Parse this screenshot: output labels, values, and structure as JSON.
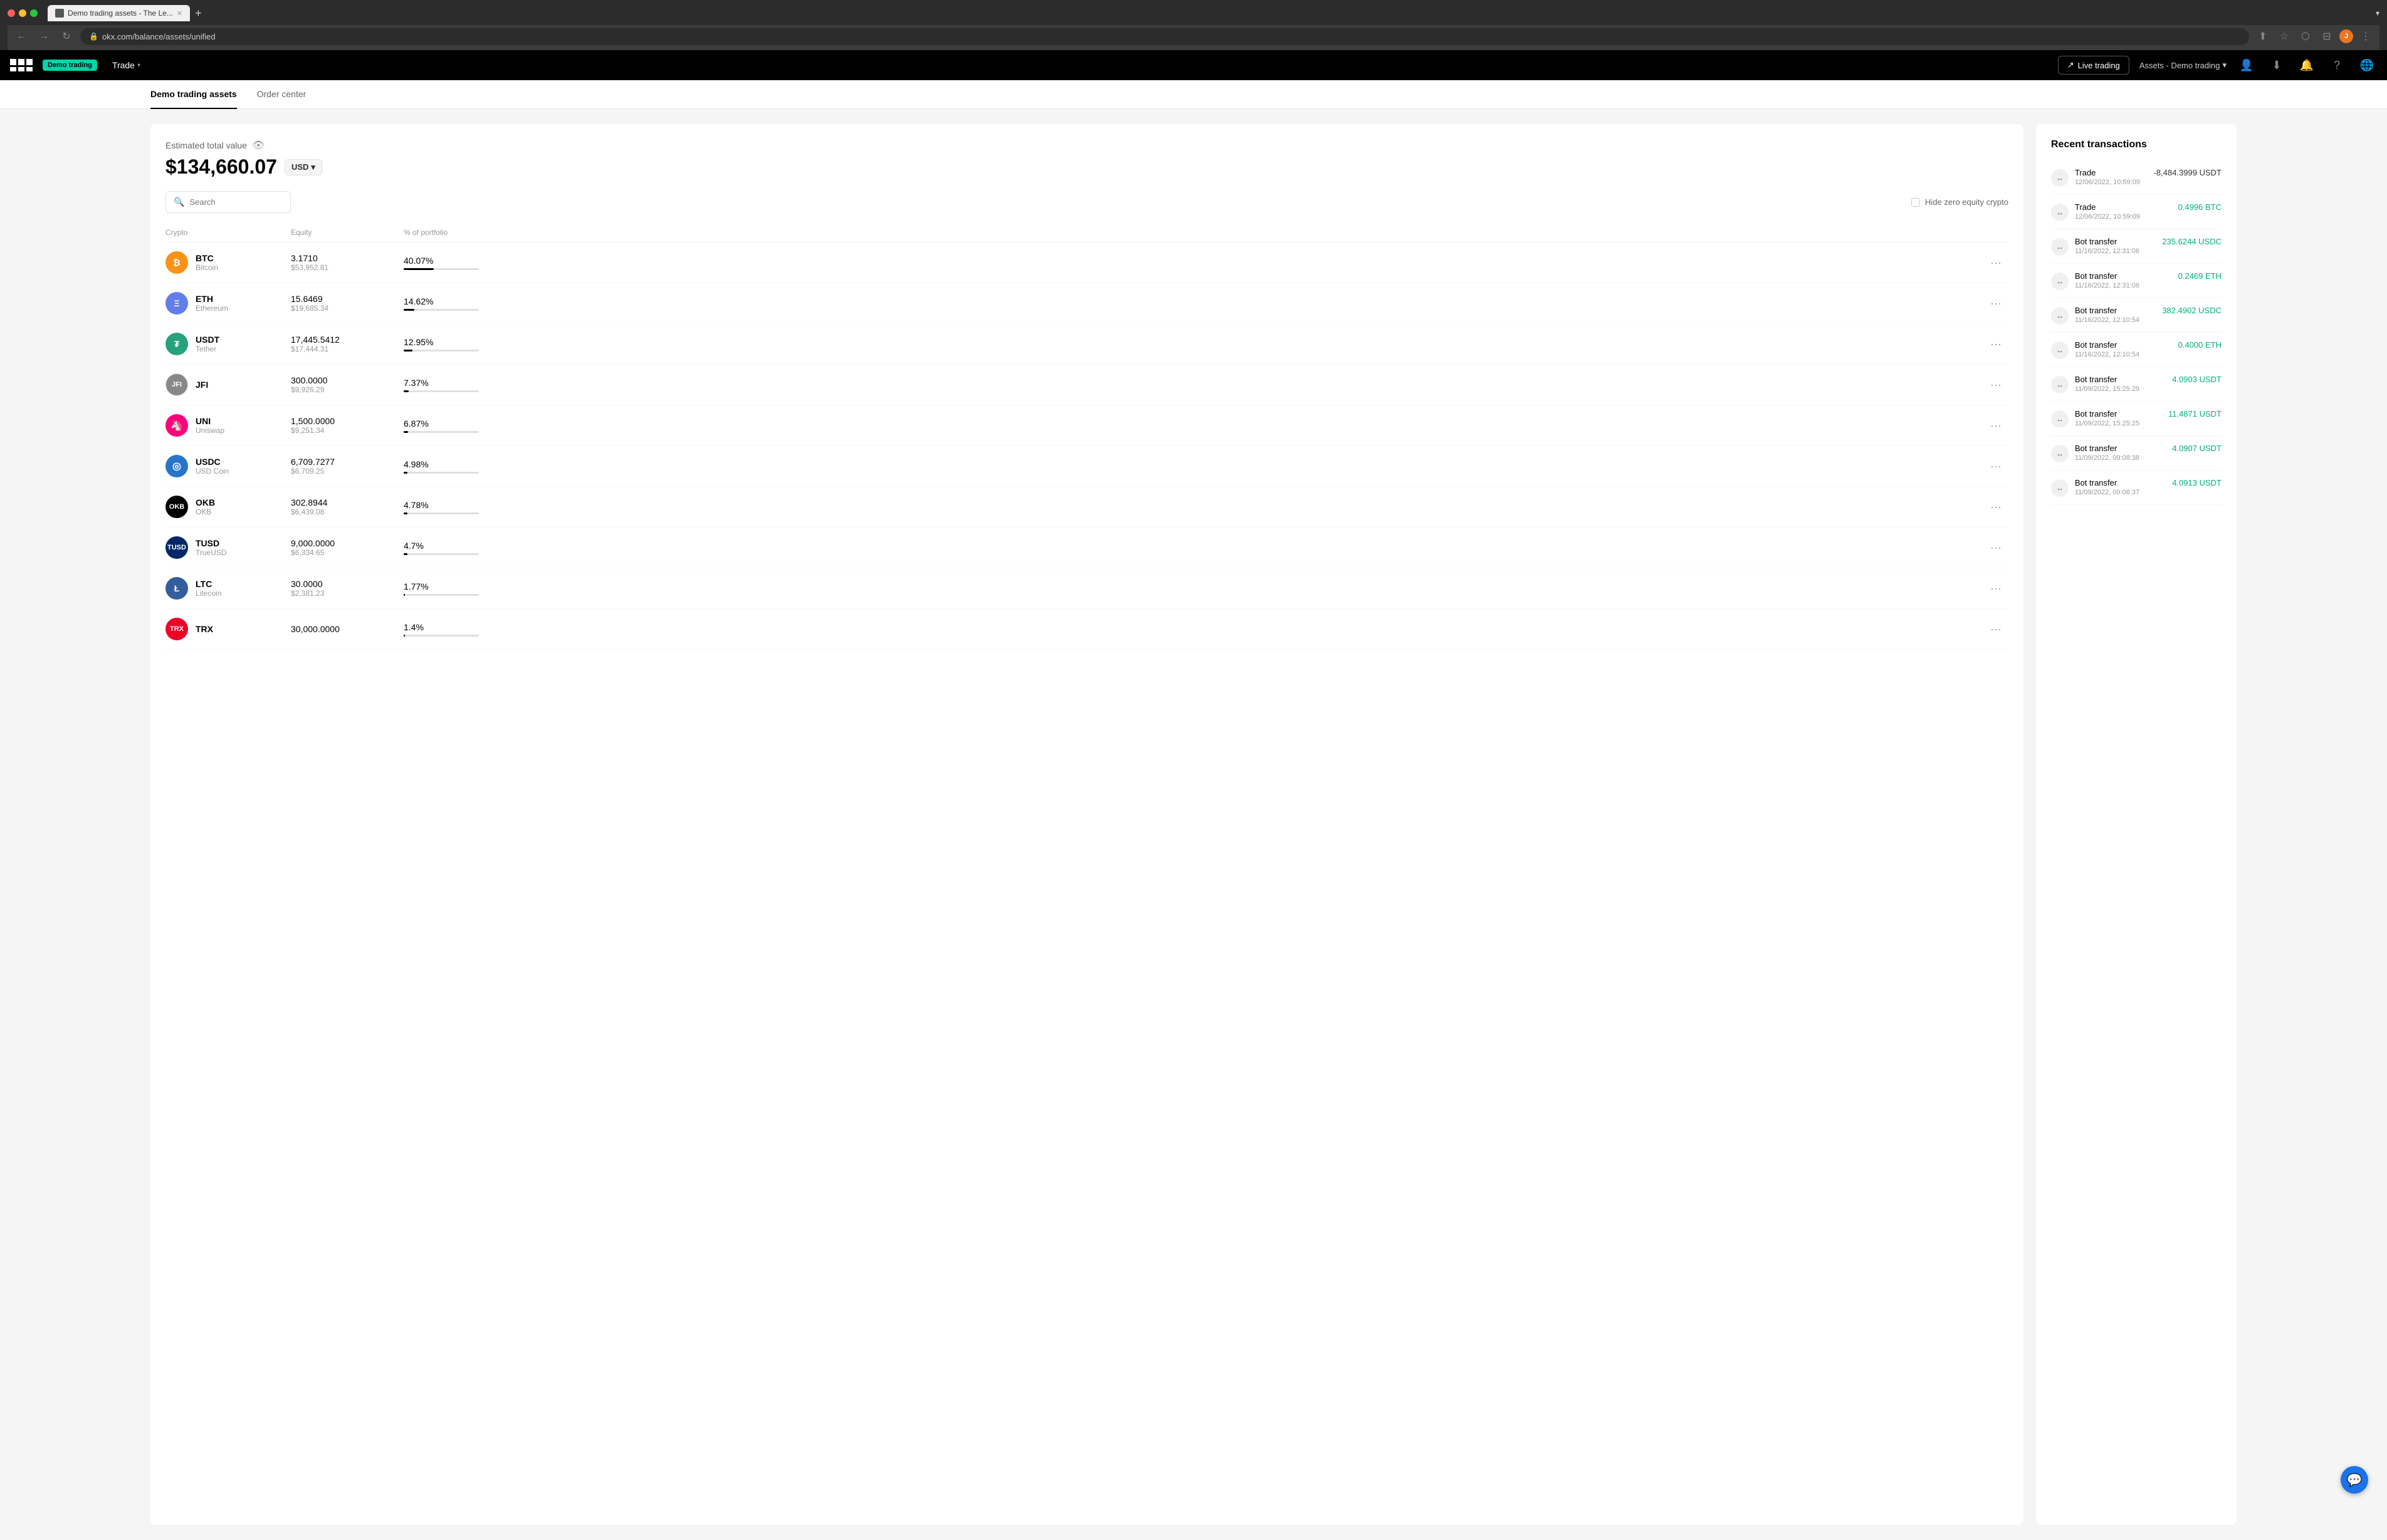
{
  "browser": {
    "tab_label": "Demo trading assets - The Le...",
    "address": "okx.com/balance/assets/unified",
    "dropdown_label": "▾"
  },
  "topnav": {
    "demo_badge": "Demo trading",
    "trade_label": "Trade",
    "live_trading_label": "Live trading",
    "assets_menu_label": "Assets - Demo trading",
    "chevron": "▾"
  },
  "subnav": {
    "tabs": [
      {
        "label": "Demo trading assets",
        "active": true
      },
      {
        "label": "Order center",
        "active": false
      }
    ]
  },
  "main": {
    "estimated_label": "Estimated total value",
    "total_value": "$134,660.07",
    "currency": "USD",
    "search_placeholder": "Search",
    "hide_zero_label": "Hide zero equity crypto",
    "table_headers": [
      "Crypto",
      "Equity",
      "% of portfolio",
      ""
    ],
    "assets": [
      {
        "symbol": "BTC",
        "name": "Bitcoin",
        "icon_class": "btc-icon",
        "icon_text": "₿",
        "amount": "3.1710",
        "usd": "$53,952.81",
        "pct": "40.07%",
        "bar": 40
      },
      {
        "symbol": "ETH",
        "name": "Ethereum",
        "icon_class": "eth-icon",
        "icon_text": "Ξ",
        "amount": "15.6469",
        "usd": "$19,685.34",
        "pct": "14.62%",
        "bar": 14
      },
      {
        "symbol": "USDT",
        "name": "Tether",
        "icon_class": "usdt-icon",
        "icon_text": "₮",
        "amount": "17,445.5412",
        "usd": "$17,444.31",
        "pct": "12.95%",
        "bar": 12
      },
      {
        "symbol": "JFI",
        "name": "",
        "icon_class": "jfi-icon",
        "icon_text": "J",
        "amount": "300.0000",
        "usd": "$9,926.29",
        "pct": "7.37%",
        "bar": 7
      },
      {
        "symbol": "UNI",
        "name": "Uniswap",
        "icon_class": "uni-icon",
        "icon_text": "🦄",
        "amount": "1,500.0000",
        "usd": "$9,251.34",
        "pct": "6.87%",
        "bar": 6
      },
      {
        "symbol": "USDC",
        "name": "USD Coin",
        "icon_class": "usdc-icon",
        "icon_text": "◎",
        "amount": "6,709.7277",
        "usd": "$6,709.25",
        "pct": "4.98%",
        "bar": 5
      },
      {
        "symbol": "OKB",
        "name": "OKB",
        "icon_class": "okb-icon",
        "icon_text": "✕",
        "amount": "302.8944",
        "usd": "$6,439.08",
        "pct": "4.78%",
        "bar": 5
      },
      {
        "symbol": "TUSD",
        "name": "TrueUSD",
        "icon_class": "tusd-icon",
        "icon_text": "T",
        "amount": "9,000.0000",
        "usd": "$6,334.65",
        "pct": "4.7%",
        "bar": 5
      },
      {
        "symbol": "LTC",
        "name": "Litecoin",
        "icon_class": "ltc-icon",
        "icon_text": "Ł",
        "amount": "30.0000",
        "usd": "$2,381.23",
        "pct": "1.77%",
        "bar": 2
      },
      {
        "symbol": "TRX",
        "name": "",
        "icon_class": "trx-icon",
        "icon_text": "T",
        "amount": "30,000.0000",
        "usd": "",
        "pct": "1.4%",
        "bar": 1
      }
    ]
  },
  "recent_transactions": {
    "title": "Recent transactions",
    "items": [
      {
        "type": "Trade",
        "date": "12/06/2022, 10:59:09",
        "amount": "-8,484.3999 USDT",
        "positive": false
      },
      {
        "type": "Trade",
        "date": "12/06/2022, 10:59:09",
        "amount": "0.4996 BTC",
        "positive": true
      },
      {
        "type": "Bot transfer",
        "date": "11/16/2022, 12:31:06",
        "amount": "235.6244 USDC",
        "positive": true
      },
      {
        "type": "Bot transfer",
        "date": "11/16/2022, 12:31:06",
        "amount": "0.2469 ETH",
        "positive": true
      },
      {
        "type": "Bot transfer",
        "date": "11/16/2022, 12:10:54",
        "amount": "382.4902 USDC",
        "positive": true
      },
      {
        "type": "Bot transfer",
        "date": "11/16/2022, 12:10:54",
        "amount": "0.4000 ETH",
        "positive": true
      },
      {
        "type": "Bot transfer",
        "date": "11/09/2022, 15:25:29",
        "amount": "4.0903 USDT",
        "positive": true
      },
      {
        "type": "Bot transfer",
        "date": "11/09/2022, 15:25:25",
        "amount": "11.4871 USDT",
        "positive": true
      },
      {
        "type": "Bot transfer",
        "date": "11/09/2022, 09:08:38",
        "amount": "4.0907 USDT",
        "positive": true
      },
      {
        "type": "Bot transfer",
        "date": "11/09/2022, 09:08:37",
        "amount": "4.0913 USDT",
        "positive": true
      }
    ]
  }
}
